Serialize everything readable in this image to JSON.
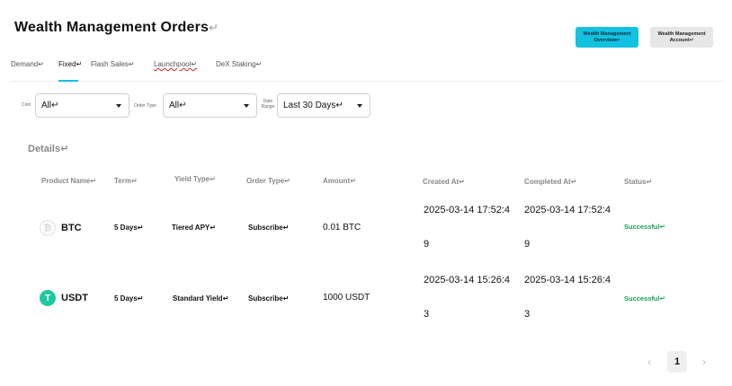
{
  "header": {
    "title": "Wealth Management Orders",
    "return_mark": "↵",
    "overview_button": "Wealth Management Overview↵",
    "account_button": "Wealth Management Account↵"
  },
  "tabs": [
    {
      "label": "Demand↵",
      "active": false
    },
    {
      "label": "Fixed↵",
      "active": true
    },
    {
      "label": "Flash Sales↵",
      "active": false
    },
    {
      "label": "Launchpool↵",
      "active": false
    },
    {
      "label": "DeX Staking↵",
      "active": false
    }
  ],
  "filters": {
    "coin_label": "Coin",
    "coin_value": "All↵",
    "order_type_label": "Order Type",
    "order_type_value": "All↵",
    "date_range_label": "Date Range",
    "date_range_value": "Last 30 Days↵"
  },
  "details": {
    "title": "Details↵",
    "columns": [
      "Product Name↵",
      "Term↵",
      "Yield Type↵",
      "Order Type↵",
      "Amount↵",
      "Created At↵",
      "Completed At↵",
      "Status↵"
    ],
    "rows": [
      {
        "coin": "BTC",
        "coin_icon": "bitcoin-icon",
        "term": "5 Days↵",
        "yield_type": "Tiered APY↵",
        "order_type": "Subscribe↵",
        "amount": "0.01 BTC",
        "created_at": "2025-03-14 17:52:49",
        "completed_at": "2025-03-14 17:52:49",
        "status": "Successful↵"
      },
      {
        "coin": "USDT",
        "coin_icon": "tether-icon",
        "term": "5 Days↵",
        "yield_type": "Standard Yield↵",
        "order_type": "Subscribe↵",
        "amount": "1000 USDT",
        "created_at": "2025-03-14 15:26:43",
        "completed_at": "2025-03-14 15:26:43",
        "status": "Successful↵"
      }
    ]
  },
  "pagination": {
    "prev": "‹",
    "current_page": "1",
    "next": "›"
  },
  "colors": {
    "accent": "#13c1e0",
    "success": "#1aa04e",
    "tether": "#1ec8a0"
  }
}
